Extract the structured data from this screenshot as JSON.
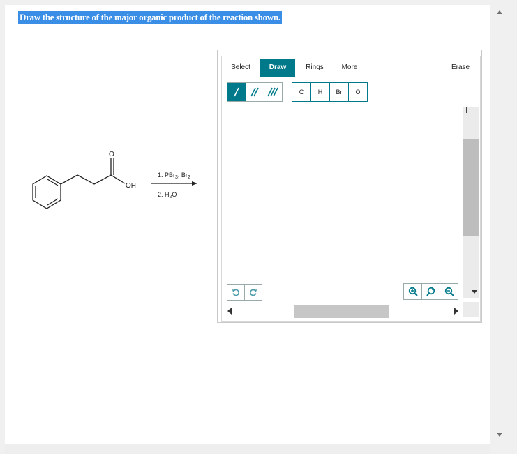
{
  "question": {
    "text": "Draw the structure of the major organic product of the reaction shown."
  },
  "reaction": {
    "reagent_step1": "1. PBr",
    "reagent_step1_sub1": "3",
    "reagent_step1_mid": ", Br",
    "reagent_step1_sub2": "2",
    "reagent_step2": "2. H",
    "reagent_step2_sub": "2",
    "reagent_step2_end": "O",
    "atom_oxygen": "O",
    "atom_oh": "OH"
  },
  "editor": {
    "tabs": [
      {
        "label": "Select",
        "active": false
      },
      {
        "label": "Draw",
        "active": true
      },
      {
        "label": "Rings",
        "active": false
      },
      {
        "label": "More",
        "active": false
      },
      {
        "label": "Erase",
        "active": false
      }
    ],
    "bond_tools": [
      "single-bond",
      "double-bond",
      "triple-bond"
    ],
    "atoms": [
      "C",
      "H",
      "Br",
      "O"
    ],
    "accent_color": "#007a8a"
  }
}
